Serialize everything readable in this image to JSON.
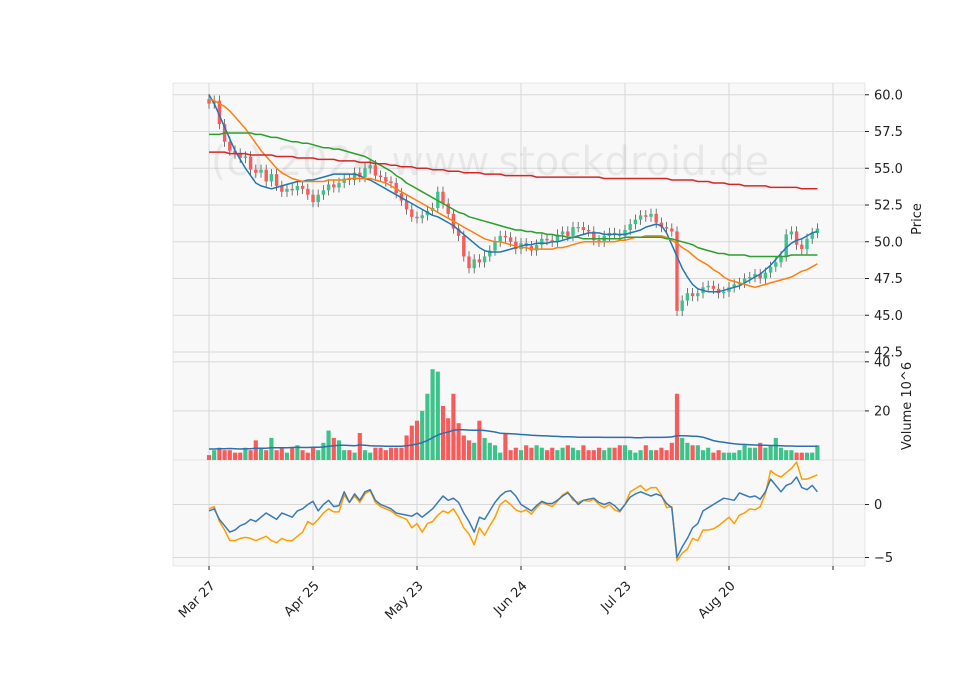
{
  "watermark": "(c) 2024 www.stockdroid.de",
  "chart_data": {
    "type": "candlestick",
    "colors": {
      "up": "#3bc38a",
      "down": "#f95b5b",
      "grid": "#d8d8d8",
      "panel": "#f8f8f8",
      "ma_short": "#1f77b4",
      "ma_mid": "#ff7f0e",
      "ma_long": "#2ca02c",
      "ma_xlong": "#d62728",
      "osc_a": "#3a7ab8",
      "osc_b": "#ff9f00",
      "vol_ma": "#2b6fb0"
    },
    "x_ticks": [
      {
        "i": 0,
        "label": "Mar 27"
      },
      {
        "i": 20,
        "label": "Apr 25"
      },
      {
        "i": 40,
        "label": "May 23"
      },
      {
        "i": 60,
        "label": "Jun 24"
      },
      {
        "i": 80,
        "label": "Jul 23"
      },
      {
        "i": 100,
        "label": "Aug 20"
      },
      {
        "i": 120,
        "label": ""
      }
    ],
    "price_panel": {
      "ylabel": "Price",
      "ylim": [
        42.5,
        60.8
      ],
      "ticks": [
        42.5,
        45.0,
        47.5,
        50.0,
        52.5,
        55.0,
        57.5,
        60.0
      ],
      "tick_labels": [
        "42.5",
        "45.0",
        "47.5",
        "50.0",
        "52.5",
        "55.0",
        "57.5",
        "60.0"
      ],
      "closes": [
        59.4,
        59.6,
        58.0,
        56.8,
        56.2,
        56.0,
        55.7,
        55.8,
        54.9,
        54.7,
        54.9,
        54.1,
        54.6,
        53.8,
        53.4,
        53.6,
        53.5,
        53.8,
        53.6,
        53.2,
        52.7,
        53.2,
        53.5,
        53.9,
        53.7,
        54.0,
        54.3,
        54.2,
        54.7,
        54.4,
        55.0,
        55.2,
        54.5,
        54.4,
        54.1,
        54.0,
        53.3,
        52.8,
        52.2,
        51.7,
        51.6,
        51.8,
        52.1,
        52.3,
        53.4,
        52.6,
        51.9,
        50.9,
        50.4,
        49.0,
        48.2,
        48.8,
        48.6,
        49.0,
        49.4,
        50.0,
        50.4,
        50.3,
        50.0,
        49.5,
        49.9,
        49.7,
        49.4,
        49.8,
        50.2,
        50.1,
        50.0,
        50.5,
        50.7,
        50.4,
        51.0,
        51.0,
        50.8,
        50.7,
        50.1,
        50.0,
        50.4,
        50.6,
        50.5,
        50.4,
        50.8,
        51.2,
        51.5,
        51.8,
        51.7,
        51.9,
        51.3,
        51.0,
        50.9,
        50.7,
        45.3,
        46.0,
        46.5,
        46.3,
        46.5,
        46.9,
        47.0,
        46.8,
        46.5,
        46.6,
        46.9,
        47.1,
        47.2,
        47.5,
        47.6,
        47.8,
        47.5,
        47.9,
        48.3,
        48.6,
        49.0,
        50.5,
        50.7,
        49.8,
        49.5,
        50.2,
        50.6,
        50.9
      ],
      "moving_averages": [
        {
          "name": "ma_short",
          "color": "#1f77b4",
          "values": [
            60.0,
            59.4,
            58.6,
            57.8,
            57.0,
            56.2,
            55.6,
            55.0,
            54.5,
            54.0,
            53.8,
            53.7,
            53.6,
            53.7,
            53.8,
            53.9,
            54.0,
            54.1,
            54.1,
            54.2,
            54.2,
            54.3,
            54.4,
            54.5,
            54.6,
            54.6,
            54.6,
            54.6,
            54.6,
            54.5,
            54.3,
            54.2,
            54.0,
            53.8,
            53.6,
            53.4,
            53.2,
            53.0,
            52.8,
            52.6,
            52.4,
            52.2,
            52.0,
            51.8,
            51.7,
            51.5,
            51.3,
            51.1,
            50.8,
            50.5,
            50.2,
            49.9,
            49.6,
            49.4,
            49.3,
            49.3,
            49.3,
            49.4,
            49.5,
            49.6,
            49.7,
            49.8,
            49.8,
            49.9,
            49.9,
            49.9,
            50.0,
            50.0,
            50.1,
            50.2,
            50.3,
            50.4,
            50.5,
            50.6,
            50.6,
            50.6,
            50.5,
            50.5,
            50.5,
            50.5,
            50.5,
            50.6,
            50.7,
            50.8,
            51.0,
            51.1,
            51.2,
            51.1,
            50.6,
            49.8,
            49.0,
            48.2,
            47.6,
            47.1,
            46.8,
            46.7,
            46.6,
            46.6,
            46.6,
            46.7,
            46.8,
            46.9,
            47.0,
            47.2,
            47.4,
            47.6,
            47.8,
            48.1,
            48.4,
            48.8,
            49.2,
            49.6,
            49.9,
            50.1,
            50.2,
            50.4,
            50.6,
            50.7
          ]
        },
        {
          "name": "ma_mid",
          "color": "#ff7f0e",
          "values": [
            59.7,
            59.6,
            59.4,
            59.2,
            58.9,
            58.5,
            58.1,
            57.7,
            57.2,
            56.7,
            56.2,
            55.8,
            55.4,
            55.0,
            54.7,
            54.5,
            54.3,
            54.2,
            54.1,
            54.1,
            54.1,
            54.1,
            54.1,
            54.2,
            54.2,
            54.2,
            54.2,
            54.3,
            54.3,
            54.3,
            54.3,
            54.3,
            54.2,
            54.1,
            54.0,
            53.8,
            53.6,
            53.4,
            53.2,
            53.0,
            52.8,
            52.6,
            52.4,
            52.2,
            52.0,
            51.8,
            51.6,
            51.4,
            51.2,
            51.0,
            50.8,
            50.6,
            50.4,
            50.2,
            50.1,
            50.0,
            50.0,
            49.9,
            49.8,
            49.7,
            49.6,
            49.6,
            49.5,
            49.5,
            49.5,
            49.5,
            49.5,
            49.6,
            49.6,
            49.7,
            49.8,
            49.9,
            50.0,
            50.0,
            50.0,
            50.0,
            50.0,
            50.0,
            50.0,
            50.1,
            50.1,
            50.2,
            50.3,
            50.3,
            50.4,
            50.4,
            50.4,
            50.4,
            50.3,
            50.1,
            49.9,
            49.6,
            49.4,
            49.1,
            48.8,
            48.6,
            48.4,
            48.1,
            47.9,
            47.6,
            47.4,
            47.3,
            47.2,
            47.1,
            47.0,
            46.9,
            47.0,
            47.1,
            47.2,
            47.3,
            47.4,
            47.5,
            47.6,
            47.8,
            48.0,
            48.1,
            48.3,
            48.5
          ]
        },
        {
          "name": "ma_long",
          "color": "#2ca02c",
          "values": [
            57.3,
            57.3,
            57.3,
            57.4,
            57.4,
            57.4,
            57.4,
            57.4,
            57.4,
            57.3,
            57.3,
            57.2,
            57.1,
            57.1,
            57.0,
            56.9,
            56.8,
            56.8,
            56.7,
            56.7,
            56.6,
            56.5,
            56.4,
            56.4,
            56.3,
            56.3,
            56.2,
            56.1,
            56.0,
            55.9,
            55.8,
            55.6,
            55.4,
            55.2,
            55.0,
            54.8,
            54.5,
            54.3,
            54.0,
            53.8,
            53.6,
            53.4,
            53.2,
            53.0,
            52.8,
            52.6,
            52.4,
            52.2,
            52.0,
            51.9,
            51.7,
            51.6,
            51.5,
            51.4,
            51.3,
            51.2,
            51.1,
            51.0,
            50.9,
            50.8,
            50.8,
            50.7,
            50.7,
            50.6,
            50.6,
            50.5,
            50.5,
            50.4,
            50.4,
            50.3,
            50.3,
            50.3,
            50.2,
            50.2,
            50.2,
            50.2,
            50.2,
            50.2,
            50.2,
            50.2,
            50.3,
            50.3,
            50.3,
            50.3,
            50.3,
            50.3,
            50.3,
            50.3,
            50.2,
            50.2,
            50.1,
            50.0,
            49.9,
            49.8,
            49.6,
            49.5,
            49.4,
            49.3,
            49.2,
            49.2,
            49.1,
            49.1,
            49.1,
            49.1,
            49.0,
            49.0,
            49.0,
            49.0,
            49.0,
            49.0,
            49.0,
            49.0,
            49.1,
            49.1,
            49.1,
            49.1,
            49.1,
            49.1
          ]
        },
        {
          "name": "ma_xlong",
          "color": "#d62728",
          "values": [
            56.1,
            56.1,
            56.1,
            56.1,
            56.0,
            56.0,
            56.0,
            56.0,
            55.9,
            55.9,
            55.9,
            55.9,
            55.9,
            55.8,
            55.8,
            55.8,
            55.8,
            55.7,
            55.7,
            55.7,
            55.7,
            55.6,
            55.6,
            55.6,
            55.6,
            55.5,
            55.5,
            55.5,
            55.5,
            55.4,
            55.4,
            55.4,
            55.3,
            55.3,
            55.3,
            55.2,
            55.2,
            55.1,
            55.1,
            55.1,
            55.0,
            55.0,
            55.0,
            54.9,
            54.9,
            54.9,
            54.8,
            54.8,
            54.8,
            54.7,
            54.7,
            54.7,
            54.7,
            54.6,
            54.6,
            54.6,
            54.6,
            54.5,
            54.5,
            54.5,
            54.5,
            54.5,
            54.5,
            54.4,
            54.4,
            54.4,
            54.4,
            54.4,
            54.4,
            54.4,
            54.4,
            54.4,
            54.4,
            54.4,
            54.4,
            54.4,
            54.3,
            54.3,
            54.3,
            54.3,
            54.3,
            54.3,
            54.3,
            54.3,
            54.3,
            54.3,
            54.3,
            54.3,
            54.3,
            54.2,
            54.2,
            54.2,
            54.2,
            54.2,
            54.1,
            54.1,
            54.1,
            54.0,
            54.0,
            54.0,
            53.9,
            53.9,
            53.9,
            53.8,
            53.8,
            53.8,
            53.8,
            53.8,
            53.7,
            53.7,
            53.7,
            53.7,
            53.7,
            53.7,
            53.6,
            53.6,
            53.6,
            53.6
          ]
        }
      ]
    },
    "volume_panel": {
      "ylabel": "Volume  10^6",
      "ylim": [
        0,
        44
      ],
      "ticks": [
        20,
        40
      ],
      "tick_labels": [
        "20",
        "40"
      ],
      "values": [
        2,
        4,
        5,
        4,
        4,
        3,
        3,
        5,
        4,
        8,
        5,
        4,
        9,
        4,
        5,
        3,
        5,
        6,
        4,
        3,
        5,
        4,
        7,
        12,
        9,
        8,
        4,
        4,
        3,
        11,
        4,
        3,
        5,
        5,
        4,
        5,
        5,
        5,
        10,
        14,
        16,
        20,
        27,
        37,
        36,
        22,
        17,
        27,
        15,
        10,
        8,
        7,
        16,
        9,
        7,
        6,
        3,
        11,
        4,
        5,
        4,
        6,
        5,
        6,
        5,
        4,
        5,
        4,
        5,
        6,
        5,
        4,
        6,
        4,
        4,
        5,
        4,
        5,
        5,
        6,
        6,
        4,
        3,
        4,
        6,
        4,
        4,
        5,
        4,
        7,
        27,
        9,
        7,
        6,
        6,
        4,
        5,
        3,
        4,
        3,
        3,
        3,
        4,
        6,
        5,
        5,
        7,
        5,
        6,
        9,
        5,
        4,
        4,
        3,
        3,
        3,
        3,
        6
      ],
      "ma": [
        4.5,
        4.5,
        4.6,
        4.6,
        4.7,
        4.6,
        4.5,
        4.6,
        4.6,
        4.8,
        4.8,
        4.8,
        5.0,
        5.0,
        5.0,
        5.0,
        5.1,
        5.2,
        5.1,
        5.1,
        5.2,
        5.2,
        5.3,
        5.6,
        5.8,
        6.0,
        6.0,
        5.9,
        5.8,
        6.1,
        6.0,
        5.8,
        5.7,
        5.7,
        5.6,
        5.6,
        5.6,
        5.6,
        5.8,
        6.1,
        6.5,
        7.1,
        7.9,
        9.1,
        10.2,
        10.9,
        11.4,
        12.1,
        12.3,
        12.3,
        12.2,
        12.1,
        12.2,
        12.0,
        11.7,
        11.4,
        10.9,
        10.8,
        10.7,
        10.6,
        10.4,
        10.3,
        10.1,
        10.0,
        9.9,
        9.8,
        9.7,
        9.6,
        9.5,
        9.5,
        9.4,
        9.3,
        9.3,
        9.3,
        9.3,
        9.3,
        9.2,
        9.2,
        9.2,
        9.2,
        9.2,
        9.2,
        9.1,
        9.1,
        9.2,
        9.2,
        9.2,
        9.2,
        9.3,
        9.4,
        9.9,
        9.9,
        9.8,
        9.7,
        9.6,
        9.3,
        8.6,
        7.9,
        7.5,
        7.2,
        6.9,
        6.6,
        6.4,
        6.3,
        6.2,
        6.1,
        6.0,
        6.0,
        5.9,
        5.9,
        5.8,
        5.7,
        5.7,
        5.6,
        5.6,
        5.6,
        5.6,
        5.6
      ]
    },
    "oscillator_panel": {
      "ylim": [
        -5.8,
        4.2
      ],
      "ticks": [
        -5,
        0
      ],
      "tick_labels": [
        "−5",
        "0"
      ],
      "series_a": [
        -0.6,
        -0.4,
        -1.4,
        -2.0,
        -2.6,
        -2.4,
        -2.0,
        -1.8,
        -1.4,
        -1.6,
        -1.2,
        -0.8,
        -1.1,
        -1.4,
        -0.8,
        -1.0,
        -1.2,
        -0.6,
        -0.4,
        0.0,
        0.3,
        -0.6,
        0.0,
        0.4,
        -0.2,
        -0.1,
        1.2,
        0.2,
        1.0,
        0.4,
        1.2,
        1.4,
        0.4,
        0.0,
        -0.2,
        -0.4,
        -0.8,
        -0.9,
        -1.0,
        -1.1,
        -0.8,
        -1.2,
        -0.8,
        -0.4,
        0.2,
        0.8,
        0.4,
        0.6,
        0.2,
        -0.8,
        -1.6,
        -2.6,
        -1.2,
        -1.4,
        -0.6,
        0.2,
        0.8,
        1.2,
        1.3,
        0.8,
        0.0,
        -0.3,
        -0.6,
        -0.1,
        0.3,
        0.1,
        0.1,
        0.4,
        0.8,
        1.1,
        0.6,
        0.0,
        0.4,
        0.5,
        0.6,
        0.2,
        0.0,
        0.2,
        -0.1,
        -0.6,
        0.0,
        0.7,
        1.0,
        1.2,
        1.0,
        0.8,
        1.0,
        0.8,
        0.1,
        -0.3,
        -5.0,
        -4.0,
        -3.2,
        -2.2,
        -1.8,
        -0.6,
        -0.3,
        0.0,
        0.3,
        0.6,
        0.5,
        0.4,
        1.1,
        0.9,
        0.7,
        0.8,
        0.5,
        1.2,
        2.4,
        1.8,
        1.2,
        1.8,
        2.0,
        2.6,
        1.6,
        1.4,
        1.8,
        1.2
      ],
      "series_b": [
        -0.4,
        -0.2,
        -1.6,
        -2.4,
        -3.4,
        -3.4,
        -3.2,
        -3.1,
        -3.2,
        -3.4,
        -3.2,
        -3.0,
        -3.4,
        -3.6,
        -3.2,
        -3.4,
        -3.4,
        -3.0,
        -2.6,
        -1.6,
        -1.9,
        -1.4,
        -0.8,
        -0.4,
        -0.7,
        -0.7,
        0.9,
        0.2,
        0.8,
        0.2,
        1.0,
        1.3,
        0.2,
        -0.2,
        -0.4,
        -0.6,
        -1.0,
        -1.2,
        -1.4,
        -2.2,
        -1.8,
        -2.6,
        -1.8,
        -1.6,
        -1.0,
        -0.6,
        -0.8,
        -0.4,
        -1.2,
        -2.2,
        -2.8,
        -3.8,
        -2.2,
        -2.9,
        -2.0,
        -1.2,
        0.0,
        0.4,
        0.0,
        -0.5,
        -0.7,
        -0.5,
        -0.9,
        -0.3,
        0.2,
        0.0,
        -0.2,
        0.3,
        0.9,
        1.2,
        0.4,
        0.2,
        0.4,
        0.3,
        0.5,
        0.0,
        -0.3,
        0.0,
        -0.5,
        -0.7,
        0.0,
        1.2,
        1.5,
        1.8,
        1.3,
        1.6,
        1.6,
        0.9,
        -0.3,
        -0.2,
        -5.3,
        -4.6,
        -4.2,
        -3.2,
        -3.4,
        -2.4,
        -2.4,
        -2.3,
        -2.0,
        -1.6,
        -1.2,
        -1.8,
        -1.0,
        -0.8,
        -0.4,
        -0.5,
        -0.2,
        1.0,
        3.2,
        2.8,
        2.6,
        3.0,
        3.4,
        4.0,
        2.4,
        2.4,
        2.6,
        2.8
      ]
    }
  }
}
